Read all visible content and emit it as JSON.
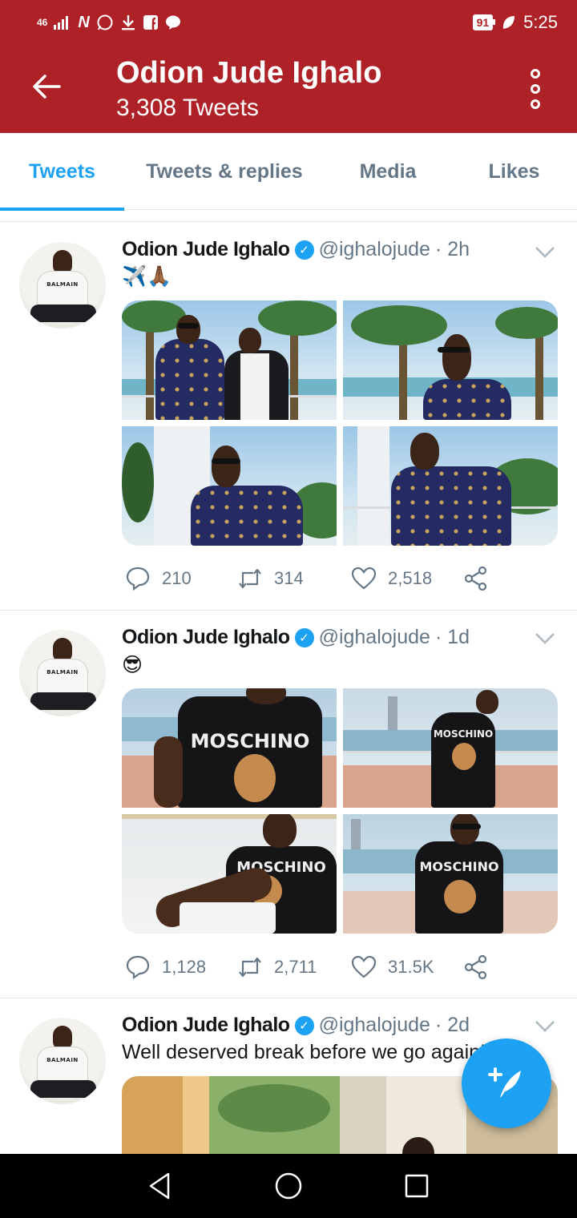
{
  "status_bar": {
    "network": "46",
    "battery": "91",
    "time": "5:25",
    "icons": [
      "signal-icon",
      "n-app-icon",
      "whatsapp-icon",
      "download-icon",
      "facebook-icon",
      "chat-icon",
      "leaf-icon"
    ]
  },
  "header": {
    "title": "Odion Jude Ighalo",
    "subtitle": "3,308 Tweets",
    "bg_color": "#ae2127"
  },
  "tabs": [
    {
      "label": "Tweets",
      "active": true
    },
    {
      "label": "Tweets & replies",
      "active": false
    },
    {
      "label": "Media",
      "active": false
    },
    {
      "label": "Likes",
      "active": false
    }
  ],
  "tweets": [
    {
      "name": "Odion Jude Ighalo",
      "handle": "@ighalojude",
      "time": "· 2h",
      "text": "✈️🙏🏾",
      "replies": "210",
      "retweets": "314",
      "likes": "2,518"
    },
    {
      "name": "Odion Jude Ighalo",
      "handle": "@ighalojude",
      "time": "· 1d",
      "text": "😎",
      "replies": "1,128",
      "retweets": "2,711",
      "likes": "31.5K",
      "shirt_label": "MOSCHINO"
    },
    {
      "name": "Odion Jude Ighalo",
      "handle": "@ighalojude",
      "time": "· 2d",
      "text": "Well deserved break before we go again!"
    }
  ],
  "avatar_brand": "BALMAIN",
  "accent_color": "#1da1f2"
}
